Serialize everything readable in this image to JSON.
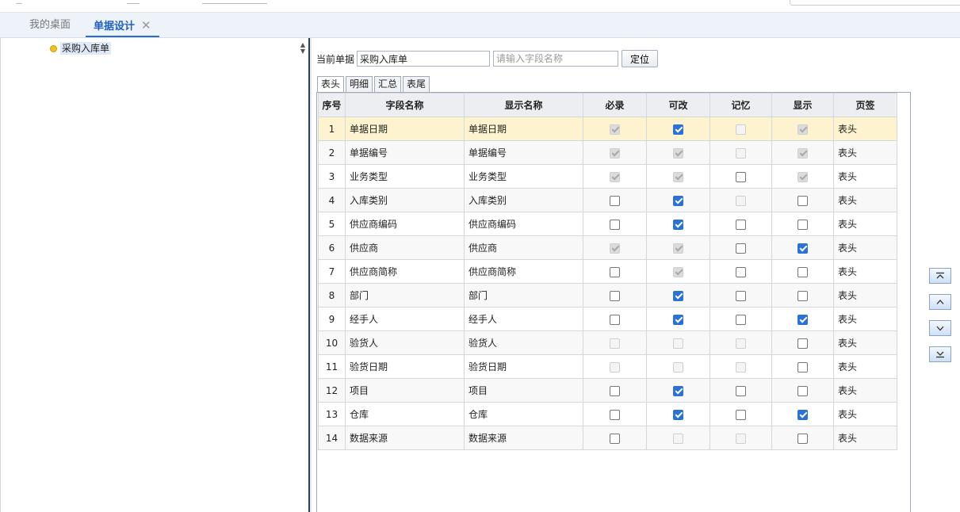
{
  "tabs": [
    {
      "label": "我的桌面",
      "active": false
    },
    {
      "label": "单据设计",
      "active": true
    }
  ],
  "tree": {
    "node_label": "采购入库单"
  },
  "toolbar": {
    "current_label": "当前单据",
    "current_value": "采购入库单",
    "search_placeholder": "请输入字段名称",
    "locate_label": "定位"
  },
  "subtabs": [
    "表头",
    "明细",
    "汇总",
    "表尾"
  ],
  "grid": {
    "columns": [
      "序号",
      "字段名称",
      "显示名称",
      "必录",
      "可改",
      "记忆",
      "显示",
      "页签"
    ],
    "rows": [
      {
        "no": "1",
        "field": "单据日期",
        "display": "单据日期",
        "required": "dc",
        "editable": "cc",
        "memory": "du",
        "show": "dc",
        "page": "表头"
      },
      {
        "no": "2",
        "field": "单据编号",
        "display": "单据编号",
        "required": "dc",
        "editable": "dc",
        "memory": "du",
        "show": "dc",
        "page": "表头"
      },
      {
        "no": "3",
        "field": "业务类型",
        "display": "业务类型",
        "required": "dc",
        "editable": "dc",
        "memory": "uu",
        "show": "dc",
        "page": "表头"
      },
      {
        "no": "4",
        "field": "入库类别",
        "display": "入库类别",
        "required": "uu",
        "editable": "cc",
        "memory": "du",
        "show": "uu",
        "page": "表头"
      },
      {
        "no": "5",
        "field": "供应商编码",
        "display": "供应商编码",
        "required": "uu",
        "editable": "cc",
        "memory": "uu",
        "show": "uu",
        "page": "表头"
      },
      {
        "no": "6",
        "field": "供应商",
        "display": "供应商",
        "required": "dc",
        "editable": "dc",
        "memory": "uu",
        "show": "cc",
        "page": "表头"
      },
      {
        "no": "7",
        "field": "供应商简称",
        "display": "供应商简称",
        "required": "uu",
        "editable": "dc",
        "memory": "uu",
        "show": "uu",
        "page": "表头"
      },
      {
        "no": "8",
        "field": "部门",
        "display": "部门",
        "required": "uu",
        "editable": "cc",
        "memory": "uu",
        "show": "uu",
        "page": "表头"
      },
      {
        "no": "9",
        "field": "经手人",
        "display": "经手人",
        "required": "uu",
        "editable": "cc",
        "memory": "uu",
        "show": "cc",
        "page": "表头"
      },
      {
        "no": "10",
        "field": "验货人",
        "display": "验货人",
        "required": "du",
        "editable": "du",
        "memory": "du",
        "show": "uu",
        "page": "表头"
      },
      {
        "no": "11",
        "field": "验货日期",
        "display": "验货日期",
        "required": "du",
        "editable": "du",
        "memory": "du",
        "show": "uu",
        "page": "表头"
      },
      {
        "no": "12",
        "field": "项目",
        "display": "项目",
        "required": "uu",
        "editable": "cc",
        "memory": "uu",
        "show": "uu",
        "page": "表头"
      },
      {
        "no": "13",
        "field": "仓库",
        "display": "仓库",
        "required": "uu",
        "editable": "cc",
        "memory": "uu",
        "show": "cc",
        "page": "表头"
      },
      {
        "no": "14",
        "field": "数据来源",
        "display": "数据来源",
        "required": "uu",
        "editable": "du",
        "memory": "du",
        "show": "uu",
        "page": "表头"
      }
    ]
  },
  "move_buttons": [
    "move-top-icon",
    "move-up-icon",
    "move-down-icon",
    "move-bottom-icon"
  ],
  "colors": {
    "accent": "#2b72d8",
    "selected_row": "#fdf3cf",
    "header_bg": "#eceef2"
  }
}
